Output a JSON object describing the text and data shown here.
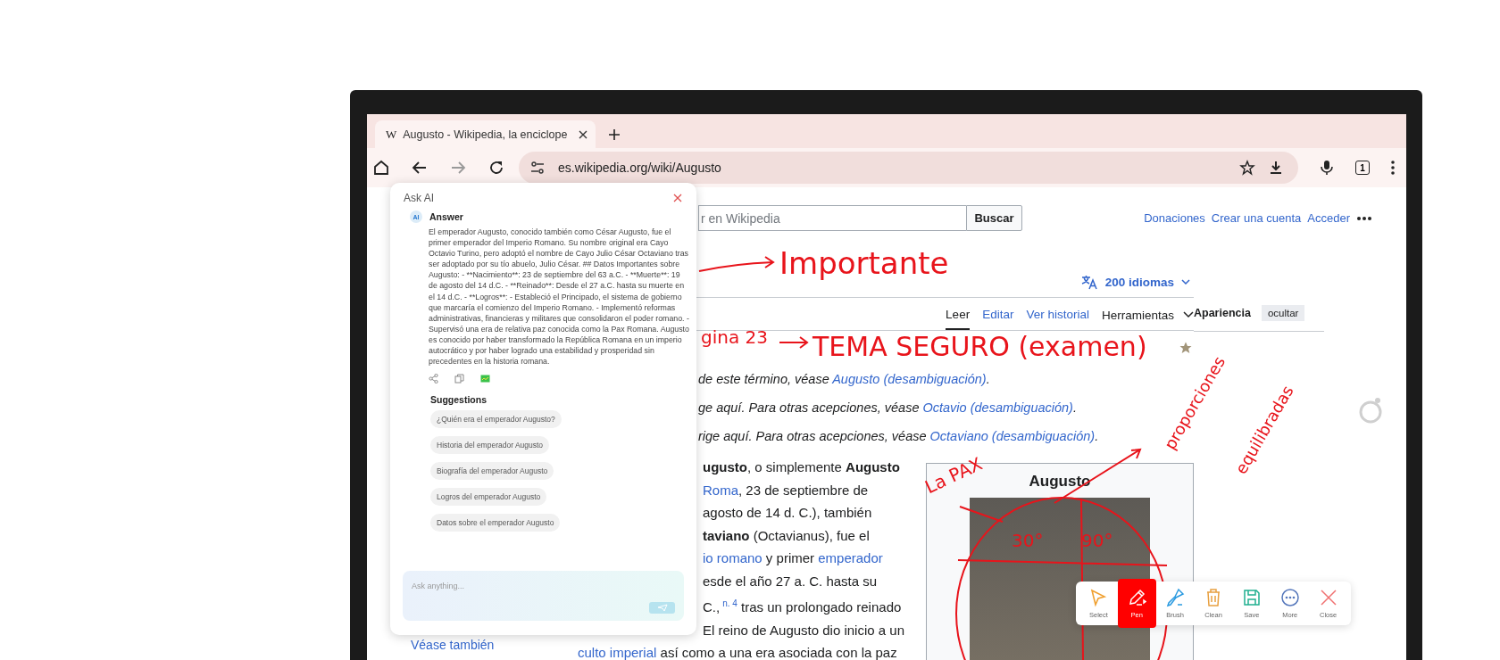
{
  "browser": {
    "tab": {
      "favicon": "W",
      "title": "Augusto - Wikipedia, la enciclope"
    },
    "url": "es.wikipedia.org/wiki/Augusto",
    "tab_count": "1"
  },
  "wiki": {
    "search": {
      "placeholder": "r en Wikipedia",
      "button": "Buscar"
    },
    "user_links": [
      "Donaciones",
      "Crear una cuenta",
      "Acceder"
    ],
    "languages": "200 idiomas",
    "page_tabs": [
      {
        "label": "Leer",
        "selected": true
      },
      {
        "label": "Editar",
        "selected": false
      },
      {
        "label": "Ver historial",
        "selected": false
      }
    ],
    "tools": "Herramientas",
    "appearance": {
      "title": "Apariencia",
      "button": "ocultar"
    },
    "hatnotes": [
      [
        {
          "text": "de este término, véase "
        },
        {
          "text": "Augusto (desambiguación)",
          "kind": "link"
        },
        {
          "text": "."
        }
      ],
      [
        {
          "text": "ge aquí. Para otras acepciones, véase "
        },
        {
          "text": "Octavio (desambiguación)",
          "kind": "link"
        },
        {
          "text": "."
        }
      ],
      [
        {
          "text": "rige aquí. Para otras acepciones, véase "
        },
        {
          "text": "Octaviano (desambiguación)",
          "kind": "link"
        },
        {
          "text": "."
        }
      ]
    ],
    "paragraph_lines": [
      [
        {
          "text": "ugusto",
          "kind": "bold"
        },
        {
          "text": ", o simplemente "
        },
        {
          "text": "Augusto",
          "kind": "bold"
        }
      ],
      [
        {
          "text": "Roma",
          "kind": "link"
        },
        {
          "text": ", 23 de septiembre de"
        }
      ],
      [
        {
          "text": "agosto de 14 d. C.), también"
        }
      ],
      [
        {
          "text": "taviano",
          "kind": "bold"
        },
        {
          "text": " (Octavianus), fue el"
        }
      ],
      [
        {
          "text": "io romano",
          "kind": "link"
        },
        {
          "text": " y primer "
        },
        {
          "text": "emperador",
          "kind": "link"
        }
      ],
      [
        {
          "text": "esde el año 27 a. C. hasta su"
        }
      ],
      [
        {
          "text": "C.,"
        },
        {
          "text": "n. 4",
          "kind": "note"
        },
        {
          "text": "  tras un prolongado reinado"
        }
      ],
      [
        {
          "text": "El reino de Augusto dio inicio a un"
        }
      ]
    ],
    "paragraph_below_panel": [
      [
        {
          "text": "culto imperial",
          "kind": "link"
        },
        {
          "text": " así como a una era asociada con la paz"
        }
      ]
    ],
    "infobox": {
      "title": "Augusto"
    },
    "sidebar_link": "Véase también"
  },
  "ask_ai": {
    "title": "Ask AI",
    "logo_text": "AI",
    "answer_heading": "Answer",
    "answer": "El emperador Augusto, conocido también como César Augusto, fue el primer emperador del Imperio Romano. Su nombre original era Cayo Octavio Turino, pero adoptó el nombre de Cayo Julio César Octaviano tras ser adoptado por su tío abuelo, Julio César. ## Datos Importantes sobre Augusto: - **Nacimiento**: 23 de septiembre del 63 a.C. - **Muerte**: 19 de agosto del 14 d.C. - **Reinado**: Desde el 27 a.C. hasta su muerte en el 14 d.C. - **Logros**: - Estableció el Principado, el sistema de gobierno que marcaría el comienzo del Imperio Romano. - Implementó reformas administrativas, financieras y militares que consolidaron el poder romano. - Supervisó una era de relativa paz conocida como la Pax Romana. Augusto es conocido por haber transformado la República Romana en un imperio autocrático y por haber logrado una estabilidad y prosperidad sin precedentes en la historia romana.",
    "suggestions_heading": "Suggestions",
    "suggestions": [
      "¿Quién era el emperador Augusto?",
      "Historia del emperador Augusto",
      "Biografía del emperador Augusto",
      "Logros del emperador Augusto",
      "Datos sobre el emperador Augusto"
    ],
    "input": {
      "placeholder": "Ask anything..."
    }
  },
  "pen_toolbar": [
    {
      "label": "Select",
      "selected": false
    },
    {
      "label": "Pen",
      "selected": true
    },
    {
      "label": "Brush",
      "selected": false
    },
    {
      "label": "Clean",
      "selected": false
    },
    {
      "label": "Save",
      "selected": false
    },
    {
      "label": "More",
      "selected": false
    },
    {
      "label": "Close",
      "selected": false
    }
  ],
  "ink_notes": [
    {
      "text": "Importante"
    },
    {
      "text": "gina 23"
    },
    {
      "text": "TEMA SEGURO (examen)"
    },
    {
      "text": "La PAX"
    },
    {
      "text": "proporciones"
    },
    {
      "text": "equilibradas"
    },
    {
      "text": "30°"
    },
    {
      "text": "90°"
    }
  ]
}
